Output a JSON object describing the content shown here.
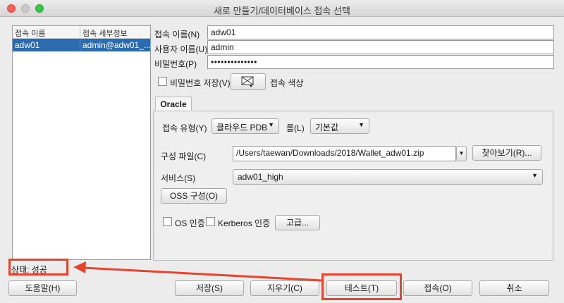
{
  "window": {
    "title": "새로 만들기/데이터베이스 접속 선택"
  },
  "connection_list": {
    "columns": [
      "접속 이름",
      "접속 세부정보"
    ],
    "rows": [
      {
        "name": "adw01",
        "details": "admin@adw01_..."
      }
    ]
  },
  "form": {
    "conn_name_label": "접속 이름(N)",
    "conn_name_value": "adw01",
    "username_label": "사용자 이름(U)",
    "username_value": "admin",
    "password_label": "비밀번호(P)",
    "password_value": "••••••••••••••",
    "save_password_label": "비밀번호 저장(V)",
    "conn_color_label": "접속 색상"
  },
  "tabs": [
    "Oracle"
  ],
  "oracle": {
    "conn_type_label": "접속 유형(Y)",
    "conn_type_value": "클라우드 PDB",
    "role_label": "롤(L)",
    "role_value": "기본값",
    "config_file_label": "구성 파일(C)",
    "config_file_value": "/Users/taewan/Downloads/2018/Wallet_adw01.zip",
    "browse_button": "찾아보기(R)...",
    "service_label": "서비스(S)",
    "service_value": "adw01_high",
    "oss_button": "OSS 구성(O)",
    "os_auth_label": "OS 인증",
    "kerberos_label": "Kerberos 인증",
    "advanced_button": "고급..."
  },
  "status_text": "상태: 성공",
  "buttons": {
    "help": "도움말(H)",
    "save": "저장(S)",
    "clear": "지우기(C)",
    "test": "테스트(T)",
    "connect": "접속(O)",
    "cancel": "취소"
  },
  "annotation_color": "#e8432d"
}
